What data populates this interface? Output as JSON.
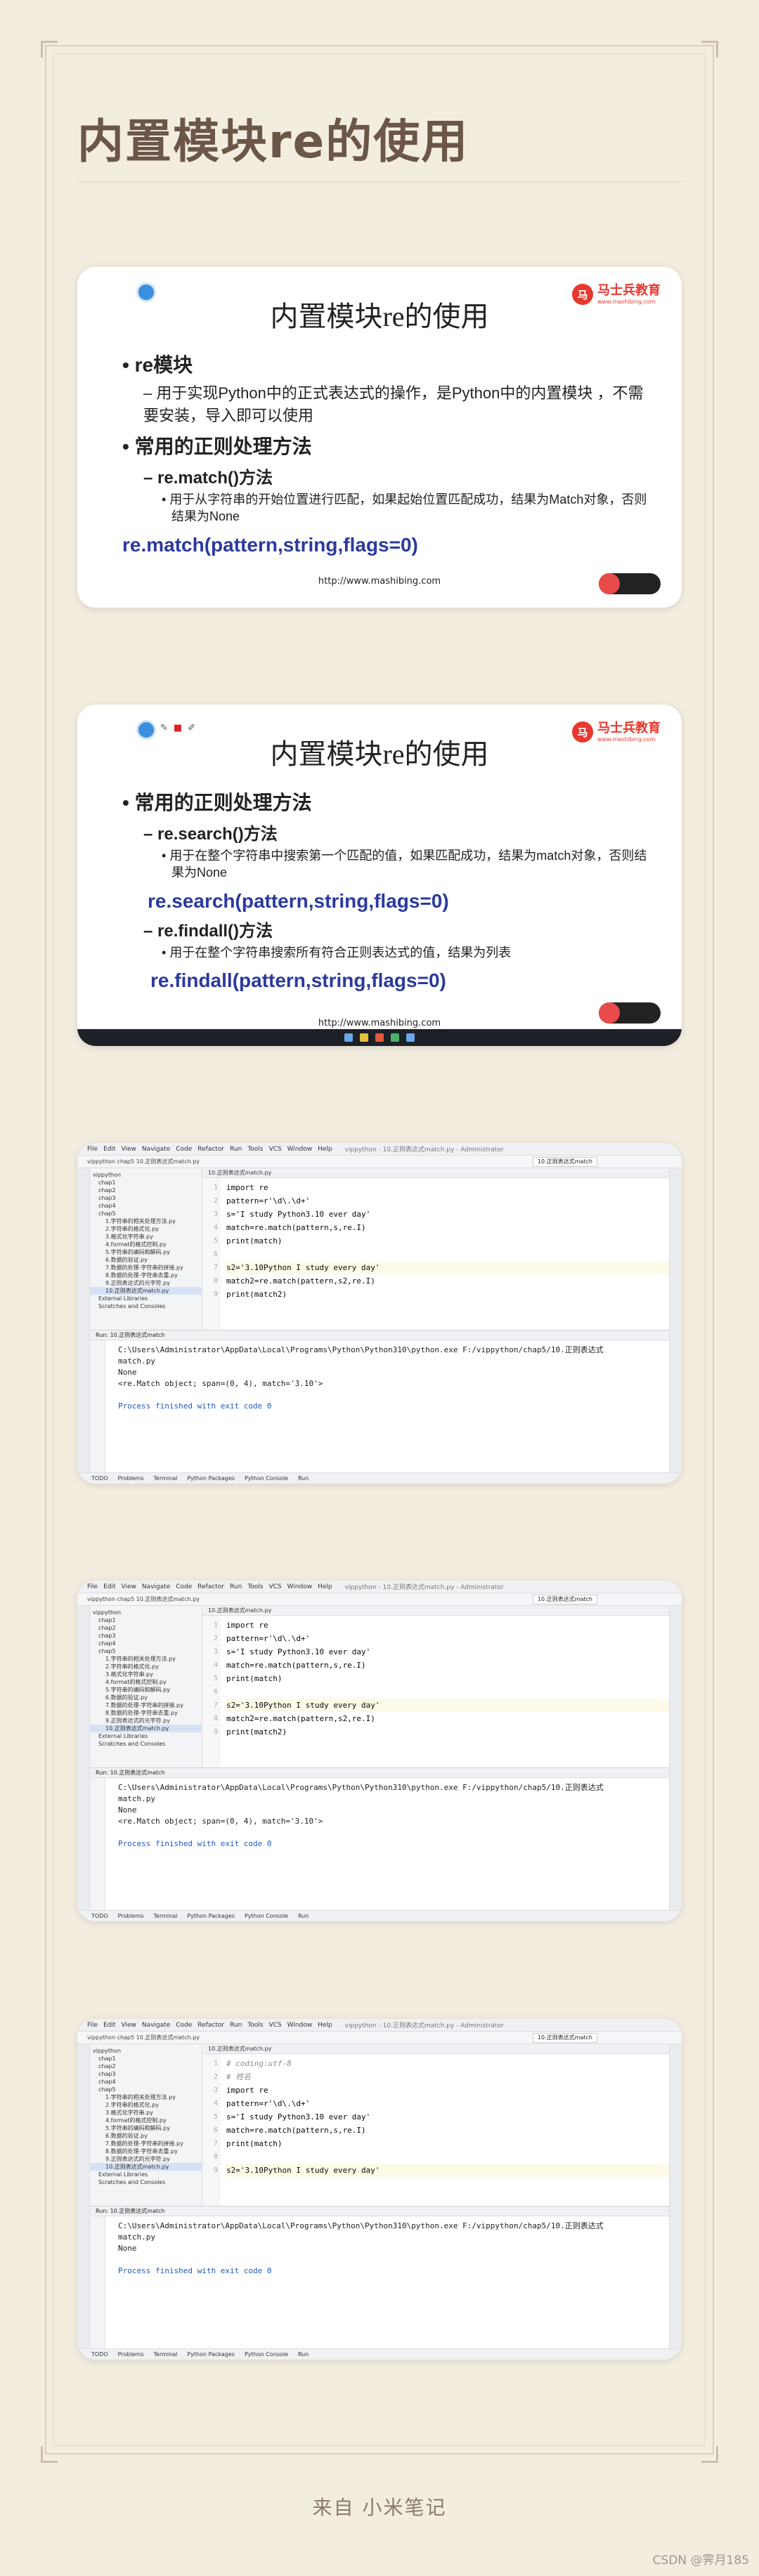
{
  "page": {
    "title": "内置模块re的使用",
    "footer_source": "来自 小米笔记",
    "watermark": "CSDN @霁月185"
  },
  "slide1": {
    "title": "内置模块re的使用",
    "brand": "马士兵教育",
    "brand_sub": "www.mashibing.com",
    "items": [
      {
        "level": 1,
        "text": "re模块"
      },
      {
        "level": 2,
        "text": "用于实现Python中的正式表达式的操作，是Python中的内置模块 ，不需要安装，导入即可以使用"
      },
      {
        "level": 1,
        "text": "常用的正则处理方法"
      },
      {
        "level": "2b",
        "text": "re.match()方法"
      },
      {
        "level": 3,
        "text": "用于从字符串的开始位置进行匹配，如果起始位置匹配成功，结果为Match对象，否则结果为None"
      }
    ],
    "signature": "re.match(pattern,string,flags=0)",
    "url": "http://www.mashibing.com"
  },
  "slide2": {
    "title": "内置模块re的使用",
    "brand": "马士兵教育",
    "brand_sub": "www.mashibing.com",
    "items": [
      {
        "level": 1,
        "text": "常用的正则处理方法"
      },
      {
        "level": "2b",
        "text": "re.search()方法"
      },
      {
        "level": 3,
        "text": "用于在整个字符串中搜索第一个匹配的值，如果匹配成功，结果为match对象，否则结果为None"
      }
    ],
    "signature1": "re.search(pattern,string,flags=0)",
    "items2": [
      {
        "level": "2b",
        "text": "re.findall()方法"
      },
      {
        "level": 3,
        "text": "用于在整个字符串搜索所有符合正则表达式的值，结果为列表"
      }
    ],
    "signature2": "re.findall(pattern,string,flags=0)",
    "url": "http://www.mashibing.com"
  },
  "ide_common": {
    "menu": [
      "File",
      "Edit",
      "View",
      "Navigate",
      "Code",
      "Refactor",
      "Run",
      "Tools",
      "VCS",
      "Window",
      "Help"
    ],
    "window_title": "vippython - 10.正则表达式match.py - Administrator",
    "breadcrumb": "vippython  chap5  10.正则表达式match.py",
    "run_config": "10.正则表达式match",
    "editor_tab": "10.正则表达式match.py",
    "project_tree": [
      "vippython",
      "chap1",
      "chap2",
      "chap3",
      "chap4",
      "chap5",
      "1.字符串的相关处理方法.py",
      "2.字符串的格式化.py",
      "3.格式化字符串.py",
      "4.format的格式控制.py",
      "5.字符串的编码和解码.py",
      "6.数据的验证.py",
      "7.数据的处理-字符串的拼接.py",
      "8.数据的处理-字符串去重.py",
      "9.正则表达式的元字符.py",
      "10.正则表达式match.py",
      "External Libraries",
      "Scratches and Consoles"
    ],
    "run_tab": "Run: 10.正则表达式match",
    "status_tabs": [
      "TODO",
      "Problems",
      "Terminal",
      "Python Packages",
      "Python Console",
      "Run"
    ]
  },
  "ide1": {
    "lines": [
      {
        "n": "1",
        "text": "import re"
      },
      {
        "n": "2",
        "text": "pattern=r'\\d\\.\\d+'"
      },
      {
        "n": "3",
        "text": "s='I study Python3.10 ever day'"
      },
      {
        "n": "4",
        "text": "match=re.match(pattern,s,re.I)"
      },
      {
        "n": "5",
        "text": "print(match)"
      },
      {
        "n": "6",
        "text": ""
      },
      {
        "n": "7",
        "text": "s2='3.10Python I study every day'"
      },
      {
        "n": "8",
        "text": "match2=re.match(pattern,s2,re.I)"
      },
      {
        "n": "9",
        "text": "print(match2)"
      }
    ],
    "console": [
      "C:\\Users\\Administrator\\AppData\\Local\\Programs\\Python\\Python310\\python.exe F:/vippython/chap5/10.正则表达式",
      "match.py",
      "None",
      "<re.Match object; span=(0, 4), match='3.10'>",
      "",
      "Process finished with exit code 0"
    ]
  },
  "ide2": {
    "lines": [
      {
        "n": "1",
        "text": "import re"
      },
      {
        "n": "2",
        "text": "pattern=r'\\d\\.\\d+'"
      },
      {
        "n": "3",
        "text": "s='I study Python3.10 ever day'"
      },
      {
        "n": "4",
        "text": "match=re.match(pattern,s,re.I)"
      },
      {
        "n": "5",
        "text": "print(match)"
      },
      {
        "n": "6",
        "text": ""
      },
      {
        "n": "7",
        "text": "s2='3.10Python I study every day'"
      },
      {
        "n": "8",
        "text": "match2=re.match(pattern,s2,re.I)"
      },
      {
        "n": "9",
        "text": "print(match2)"
      }
    ],
    "console": [
      "C:\\Users\\Administrator\\AppData\\Local\\Programs\\Python\\Python310\\python.exe F:/vippython/chap5/10.正则表达式",
      "match.py",
      "None",
      "<re.Match object; span=(0, 4), match='3.10'>",
      "",
      "Process finished with exit code 0"
    ]
  },
  "ide3": {
    "lines": [
      {
        "n": "1",
        "text": "# coding:utf-8"
      },
      {
        "n": "2",
        "text": "# 姓名"
      },
      {
        "n": "3",
        "text": "import re"
      },
      {
        "n": "4",
        "text": "pattern=r'\\d\\.\\d+'"
      },
      {
        "n": "5",
        "text": "s='I study Python3.10 ever day'"
      },
      {
        "n": "6",
        "text": "match=re.match(pattern,s,re.I)"
      },
      {
        "n": "7",
        "text": "print(match)"
      },
      {
        "n": "8",
        "text": ""
      },
      {
        "n": "9",
        "text": "s2='3.10Python I study every day'"
      }
    ],
    "console": [
      "C:\\Users\\Administrator\\AppData\\Local\\Programs\\Python\\Python310\\python.exe F:/vippython/chap5/10.正则表达式",
      "match.py",
      "None",
      "",
      "Process finished with exit code 0"
    ]
  }
}
